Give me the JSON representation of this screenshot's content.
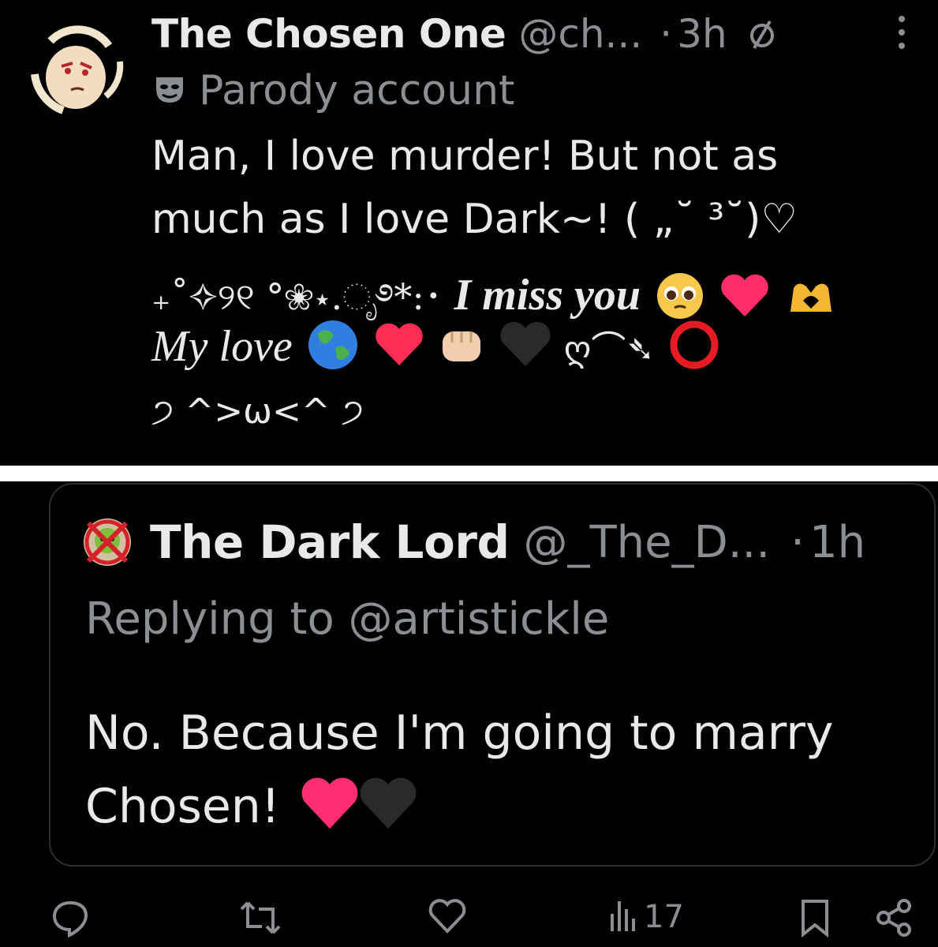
{
  "top_tweet": {
    "display_name": "The Chosen One",
    "handle": "@ch...",
    "separator": "·",
    "time": "3h",
    "parody_label": "Parody account",
    "line1": "Man, I love murder! But not as",
    "line2": "much as I love Dark~! ( „˘ ³˘)♡",
    "line3_prefix": "₊˚✧୨୧ °❀⋆.ೃ࿔*:･",
    "line3_italic": "I miss you",
    "line4_italic": "My love",
    "line4_symbol": "ღ⌒➴",
    "line5": "੭ ^>ω<^ ੭"
  },
  "quote_tweet": {
    "display_name": "The Dark Lord",
    "handle": "@_The_D...",
    "separator": "·",
    "time": "1h",
    "replying_to": "Replying to @artistickle",
    "body_line1": "No. Because I'm going to marry",
    "body_line2": "Chosen!"
  },
  "actions": {
    "views": "17"
  },
  "icons": {
    "top_avatar": "avatar-chosen-one",
    "quote_avatar": "avatar-dark-lord",
    "parody": "mask-icon",
    "more": "more-icon",
    "slash": "no-symbol-icon",
    "reply": "reply-icon",
    "retweet": "retweet-icon",
    "like": "heart-icon",
    "views": "views-icon",
    "bookmark": "bookmark-icon",
    "share": "share-icon"
  },
  "colors": {
    "background": "#000000",
    "text_primary": "#e7e9ea",
    "text_secondary": "#8b8f94",
    "card_border": "#2b2f33",
    "separator": "#ffffff"
  }
}
